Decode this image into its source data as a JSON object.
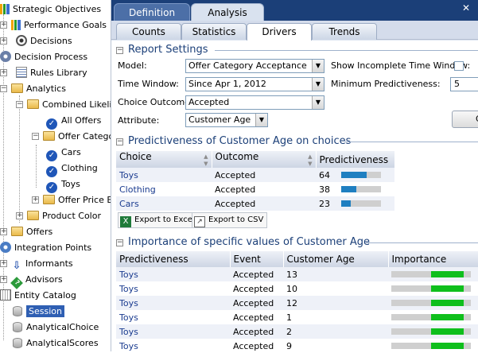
{
  "tree": {
    "strategic_objectives": "Strategic Objectives",
    "performance_goals": "Performance Goals",
    "decisions": "Decisions",
    "decision_process": "Decision Process",
    "rules_library": "Rules Library",
    "analytics": "Analytics",
    "combined_likelihood": "Combined Likelih",
    "all_offers": "All Offers",
    "offer_category": "Offer Category",
    "cars": "Cars",
    "clothing": "Clothing",
    "toys": "Toys",
    "offer_price_bracket": "Offer Price Brac",
    "product_color": "Product Color",
    "offers": "Offers",
    "integration_points": "Integration Points",
    "informants": "Informants",
    "advisors": "Advisors",
    "entity_catalog": "Entity Catalog",
    "session": "Session",
    "analytical_choice": "AnalyticalChoice",
    "analytical_scores": "AnalyticalScores"
  },
  "top_tabs": {
    "definition": "Definition",
    "analysis": "Analysis"
  },
  "sub_tabs": {
    "counts": "Counts",
    "statistics": "Statistics",
    "drivers": "Drivers",
    "trends": "Trends"
  },
  "report_settings": {
    "title": "Report Settings",
    "model_label": "Model:",
    "model_value": "Offer Category Acceptance",
    "time_window_label": "Time Window:",
    "time_window_value": "Since Apr 1, 2012",
    "choice_outcome_label": "Choice Outcome:",
    "choice_outcome_value": "Accepted",
    "attribute_label": "Attribute:",
    "attribute_value": "Customer Age",
    "show_incomplete_label": "Show Incomplete Time Window:",
    "show_incomplete_checked": false,
    "min_predictiveness_label": "Minimum Predictiveness:",
    "min_predictiveness_value": "5",
    "run_button_label": "G"
  },
  "predictiveness_section": {
    "title": "Predictiveness of Customer Age on choices",
    "headers": [
      "Choice",
      "Outcome",
      "Predictiveness"
    ],
    "rows": [
      {
        "choice": "Toys",
        "outcome": "Accepted",
        "value": "64",
        "fill": 0.64
      },
      {
        "choice": "Clothing",
        "outcome": "Accepted",
        "value": "38",
        "fill": 0.38
      },
      {
        "choice": "Cars",
        "outcome": "Accepted",
        "value": "23",
        "fill": 0.23
      }
    ],
    "export_excel": "Export to Excel",
    "export_csv": "Export to CSV"
  },
  "importance_section": {
    "title": "Importance of specific values of Customer Age",
    "headers": [
      "Predictiveness",
      "Event",
      "Customer Age",
      "Importance"
    ],
    "rows": [
      {
        "predictiveness": "Toys",
        "event": "Accepted",
        "age": "13",
        "importance": 0.9
      },
      {
        "predictiveness": "Toys",
        "event": "Accepted",
        "age": "10",
        "importance": 0.9
      },
      {
        "predictiveness": "Toys",
        "event": "Accepted",
        "age": "12",
        "importance": 0.9
      },
      {
        "predictiveness": "Toys",
        "event": "Accepted",
        "age": "1",
        "importance": 0.9
      },
      {
        "predictiveness": "Toys",
        "event": "Accepted",
        "age": "2",
        "importance": 0.9
      },
      {
        "predictiveness": "Toys",
        "event": "Accepted",
        "age": "9",
        "importance": 0.9
      }
    ]
  },
  "colors": {
    "tab_bar": "#1b3f78",
    "link": "#1a3b8f",
    "predictiveness_bar": "#1f7fc1",
    "importance_bar": "#0fbf1c",
    "selected_node": "#2f5fb3"
  }
}
